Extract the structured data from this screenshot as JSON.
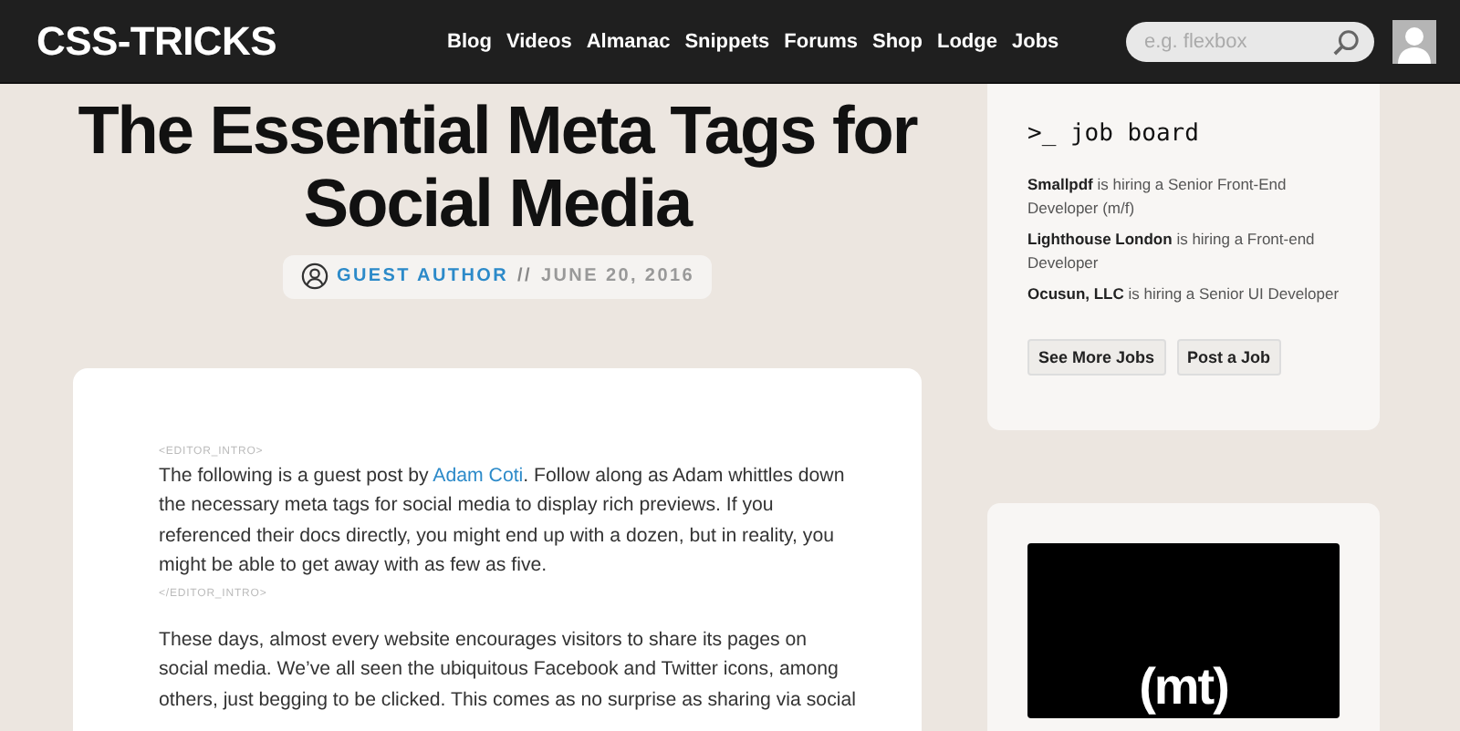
{
  "header": {
    "logo": "CSS-TRICKS",
    "nav": [
      {
        "label": "Blog"
      },
      {
        "label": "Videos"
      },
      {
        "label": "Almanac"
      },
      {
        "label": "Snippets"
      },
      {
        "label": "Forums"
      },
      {
        "label": "Shop"
      },
      {
        "label": "Lodge"
      },
      {
        "label": "Jobs"
      }
    ],
    "search": {
      "placeholder": "e.g. flexbox"
    }
  },
  "article": {
    "title": "The Essential Meta Tags for Social Media",
    "byline": {
      "author": "GUEST AUTHOR",
      "separator": "//",
      "date": "JUNE 20, 2016"
    },
    "content": [
      {
        "kind": "tag",
        "text": "<EDITOR_INTRO>"
      },
      {
        "kind": "paragraph",
        "before": "The following is a guest post by ",
        "link": "Adam Coti",
        "after": ". Follow along as Adam whittles down the necessary meta tags for social media to display rich previews. If you referenced their docs directly, you might end up with a dozen, but in reality, you might be able to get away with as few as five."
      },
      {
        "kind": "tag",
        "text": "</EDITOR_INTRO>"
      },
      {
        "kind": "paragraph",
        "before": "These days, almost every website encourages visitors to share its pages on social media. We’ve all seen the ubiquitous Facebook and Twitter icons, among others, just begging to be clicked. This comes as no surprise as sharing via social"
      }
    ]
  },
  "sidebar": {
    "job_board": {
      "title": ">_ job board",
      "jobs": [
        {
          "company": "Smallpdf",
          "text": " is hiring a Senior Front-End Developer (m/f)"
        },
        {
          "company": "Lighthouse London",
          "text": " is hiring a Front-end Developer"
        },
        {
          "company": "Ocusun, LLC",
          "text": " is hiring a Senior UI Developer"
        }
      ],
      "buttons": [
        "See More Jobs",
        "Post a Job"
      ]
    },
    "ad": {
      "logo": "(mt)"
    }
  }
}
